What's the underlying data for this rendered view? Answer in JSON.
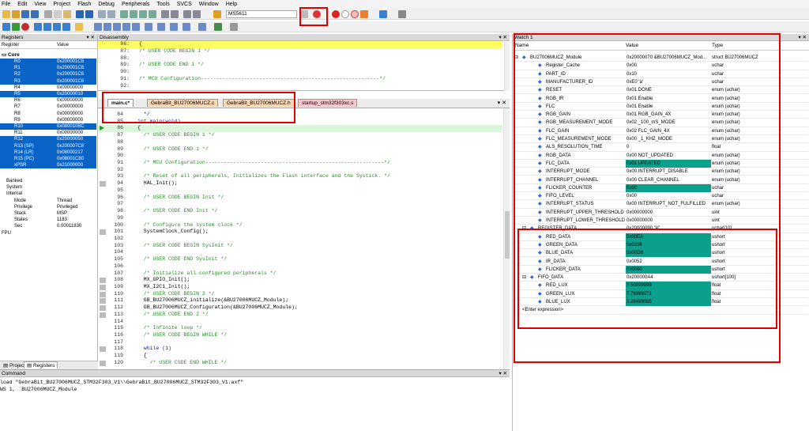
{
  "menu": [
    "File",
    "Edit",
    "View",
    "Project",
    "Flash",
    "Debug",
    "Peripherals",
    "Tools",
    "SVCS",
    "Window",
    "Help"
  ],
  "toolbar": {
    "target": "MS5611"
  },
  "registers": {
    "title": "Registers",
    "col_register": "Register",
    "col_value": "Value",
    "group_core": "Core",
    "rows": [
      {
        "n": "R0",
        "v": "0x200001C8",
        "sel": true
      },
      {
        "n": "R1",
        "v": "0x200001C8",
        "sel": true
      },
      {
        "n": "R2",
        "v": "0x200001C8",
        "sel": true
      },
      {
        "n": "R3",
        "v": "0x200001C8",
        "sel": true
      },
      {
        "n": "R4",
        "v": "0x00000000",
        "sel": false
      },
      {
        "n": "R5",
        "v": "0x20000010",
        "sel": true
      },
      {
        "n": "R6",
        "v": "0x00000000",
        "sel": false
      },
      {
        "n": "R7",
        "v": "0x00000000",
        "sel": false
      },
      {
        "n": "R8",
        "v": "0x00000000",
        "sel": false
      },
      {
        "n": "R9",
        "v": "0x00000000",
        "sel": false
      },
      {
        "n": "R10",
        "v": "0x080010BC",
        "sel": true
      },
      {
        "n": "R11",
        "v": "0x00000000",
        "sel": false
      },
      {
        "n": "R12",
        "v": "0x20000050",
        "sel": true
      },
      {
        "n": "R13 (SP)",
        "v": "0x200007C8",
        "sel": true
      },
      {
        "n": "R14 (LR)",
        "v": "0x08000217",
        "sel": true
      },
      {
        "n": "R15 (PC)",
        "v": "0x08001C80",
        "sel": true
      },
      {
        "n": "xPSR",
        "v": "0x21000000",
        "sel": true
      }
    ],
    "groups": [
      "Banked",
      "System",
      "Internal"
    ],
    "internal": [
      {
        "n": "Mode",
        "v": "Thread"
      },
      {
        "n": "Privilege",
        "v": "Privileged"
      },
      {
        "n": "Stack",
        "v": "MSP"
      },
      {
        "n": "States",
        "v": "1183"
      },
      {
        "n": "Sec",
        "v": "0.00011830"
      }
    ],
    "fpu": "FPU",
    "tab_project": "Project",
    "tab_registers": "Registers"
  },
  "disasm": {
    "title": "Disassembly",
    "lines": [
      {
        "n": "86:",
        "t": "{"
      },
      {
        "n": "87:",
        "t": "/* USER CODE BEGIN 1 */"
      },
      {
        "n": "88:",
        "t": ""
      },
      {
        "n": "89:",
        "t": "/* USER CODE END 1 */"
      },
      {
        "n": "90:",
        "t": ""
      },
      {
        "n": "91:",
        "t": "/* MCU Configuration----------------------------------------------------------*/"
      },
      {
        "n": "92:",
        "t": ""
      }
    ]
  },
  "editor": {
    "tabs": [
      "main.c*",
      "GebraBit_BU27006MUCZ.c",
      "GebraBit_BU27006MUCZ.h",
      "startup_stm32f303xc.s"
    ],
    "lines": [
      {
        "n": "84",
        "t": "  */"
      },
      {
        "n": "85",
        "t": "int main(void)"
      },
      {
        "n": "86",
        "t": "{"
      },
      {
        "n": "87",
        "t": "  /* USER CODE BEGIN 1 */"
      },
      {
        "n": "88",
        "t": ""
      },
      {
        "n": "89",
        "t": "  /* USER CODE END 1 */"
      },
      {
        "n": "90",
        "t": ""
      },
      {
        "n": "91",
        "t": "  /* MCU Configuration----------------------------------------------------------*/"
      },
      {
        "n": "92",
        "t": ""
      },
      {
        "n": "93",
        "t": "  /* Reset of all peripherals, Initializes the Flash interface and the Systick. */"
      },
      {
        "n": "94",
        "t": "  HAL_Init();"
      },
      {
        "n": "95",
        "t": ""
      },
      {
        "n": "96",
        "t": "  /* USER CODE BEGIN Init */"
      },
      {
        "n": "97",
        "t": ""
      },
      {
        "n": "98",
        "t": "  /* USER CODE END Init */"
      },
      {
        "n": "99",
        "t": ""
      },
      {
        "n": "100",
        "t": "  /* Configure the system clock */"
      },
      {
        "n": "101",
        "t": "  SystemClock_Config();"
      },
      {
        "n": "102",
        "t": ""
      },
      {
        "n": "103",
        "t": "  /* USER CODE BEGIN SysInit */"
      },
      {
        "n": "104",
        "t": ""
      },
      {
        "n": "105",
        "t": "  /* USER CODE END SysInit */"
      },
      {
        "n": "106",
        "t": ""
      },
      {
        "n": "107",
        "t": "  /* Initialize all configured peripherals */"
      },
      {
        "n": "108",
        "t": "  MX_GPIO_Init();"
      },
      {
        "n": "109",
        "t": "  MX_I2C1_Init();"
      },
      {
        "n": "110",
        "t": "  /* USER CODE BEGIN 2 */"
      },
      {
        "n": "111",
        "t": "  GB_BU27006MUCZ_initialize(&BU27006MUCZ_Module);"
      },
      {
        "n": "112",
        "t": "  GB_BU27006MUCZ_Configuration(&BU27006MUCZ_Module);"
      },
      {
        "n": "113",
        "t": "  /* USER CODE END 2 */"
      },
      {
        "n": "114",
        "t": ""
      },
      {
        "n": "115",
        "t": "  /* Infinite loop */"
      },
      {
        "n": "116",
        "t": "  /* USER CODE BEGIN WHILE */"
      },
      {
        "n": "117",
        "t": ""
      },
      {
        "n": "118",
        "t": "  while (1)"
      },
      {
        "n": "119",
        "t": "  {"
      },
      {
        "n": "120",
        "t": "    /* USER CODE END WHILE */"
      }
    ]
  },
  "command": {
    "title": "Command",
    "lines": [
      "load \"GebraBit_BU27006MUCZ_STM32F303_V1\\\\GebraBit_BU27006MUCZ_STM32F303_V1.axf\"",
      "WS 1, `BU27006MUCZ_Module"
    ]
  },
  "watch": {
    "title": "Watch 1",
    "col_name": "Name",
    "col_value": "Value",
    "col_type": "Type",
    "rows": [
      {
        "n": "BU27006MUCZ_Module",
        "v": "0x20000070 &BU27006MUCZ_Mod...",
        "t": "struct BU27006MUCZ",
        "lvl": 0,
        "hl": false,
        "exp": true
      },
      {
        "n": "Register_Cache",
        "v": "0x00",
        "t": "uchar",
        "lvl": 1,
        "hl": false
      },
      {
        "n": "PART_ID",
        "v": "0x10",
        "t": "uchar",
        "lvl": 1,
        "hl": false
      },
      {
        "n": "MANUFACTURER_ID",
        "v": "0xE0 'à'",
        "t": "uchar",
        "lvl": 1,
        "hl": false
      },
      {
        "n": "RESET",
        "v": "0x01 DONE",
        "t": "enum (uchar)",
        "lvl": 1,
        "hl": false
      },
      {
        "n": "RGB_IR",
        "v": "0x01 Enable",
        "t": "enum (uchar)",
        "lvl": 1,
        "hl": false
      },
      {
        "n": "FLC",
        "v": "0x01 Enable",
        "t": "enum (uchar)",
        "lvl": 1,
        "hl": false
      },
      {
        "n": "RGB_GAIN",
        "v": "0x01 RGB_GAIN_4X",
        "t": "enum (uchar)",
        "lvl": 1,
        "hl": false
      },
      {
        "n": "RGB_MEASUREMENT_MODE",
        "v": "0x02 _100_mS_MODE",
        "t": "enum (uchar)",
        "lvl": 1,
        "hl": false
      },
      {
        "n": "FLC_GAIN",
        "v": "0x02 FLC_GAIN_4X",
        "t": "enum (uchar)",
        "lvl": 1,
        "hl": false
      },
      {
        "n": "FLC_MEASUREMENT_MODE",
        "v": "0x00 _1_KHZ_MODE",
        "t": "enum (uchar)",
        "lvl": 1,
        "hl": false
      },
      {
        "n": "ALS_RESOLUTION_TIME",
        "v": "0",
        "t": "float",
        "lvl": 1,
        "hl": false
      },
      {
        "n": "RGB_DATA",
        "v": "0x00 NOT_UPDATED",
        "t": "enum (uchar)",
        "lvl": 1,
        "hl": false
      },
      {
        "n": "FLC_DATA",
        "v": "0x01 UPDATED",
        "t": "enum (uchar)",
        "lvl": 1,
        "hl": true
      },
      {
        "n": "INTERRUPT_MODE",
        "v": "0x00 INTERRUPT_DISABLE",
        "t": "enum (uchar)",
        "lvl": 1,
        "hl": false
      },
      {
        "n": "INTERRUPT_CHANNEL",
        "v": "0x00 CLEAR_CHANNEL",
        "t": "enum (uchar)",
        "lvl": 1,
        "hl": false
      },
      {
        "n": "FLICKER_COUNTER",
        "v": "0x00",
        "t": "uchar",
        "lvl": 1,
        "hl": true
      },
      {
        "n": "FIFO_LEVEL",
        "v": "0x00",
        "t": "uchar",
        "lvl": 1,
        "hl": false
      },
      {
        "n": "INTERRUPT_STATUS",
        "v": "0x00 INTERRUPT_NOT_FULFILLED",
        "t": "enum (uchar)",
        "lvl": 1,
        "hl": false
      },
      {
        "n": "INTERRUPT_UPPER_THRESHOLD",
        "v": "0x00000000",
        "t": "uint",
        "lvl": 1,
        "hl": false
      },
      {
        "n": "INTERRUPT_LOWER_THRESHOLD",
        "v": "0x00000000",
        "t": "uint",
        "lvl": 1,
        "hl": false
      },
      {
        "n": "REGISTER_DATA",
        "v": "0x20000090 \"è\"",
        "t": "uchar[10]",
        "lvl": 1,
        "hl": false,
        "exp": true
      },
      {
        "n": "RED_DATA",
        "v": "0x00EA",
        "t": "ushort",
        "lvl": 1,
        "hl": true
      },
      {
        "n": "GREEN_DATA",
        "v": "0x0208",
        "t": "ushort",
        "lvl": 1,
        "hl": true
      },
      {
        "n": "BLUE_DATA",
        "v": "0x00DB",
        "t": "ushort",
        "lvl": 1,
        "hl": true
      },
      {
        "n": "IR_DATA",
        "v": "0x0052",
        "t": "ushort",
        "lvl": 1,
        "hl": false
      },
      {
        "n": "FLICKER_DATA",
        "v": "0x0060",
        "t": "ushort",
        "lvl": 1,
        "hl": true
      },
      {
        "n": "FIFO_DATA",
        "v": "0x200000A4",
        "t": "ushort[100]",
        "lvl": 1,
        "hl": false,
        "exp": true
      },
      {
        "n": "RED_LUX",
        "v": "3.50999999",
        "t": "float",
        "lvl": 1,
        "hl": true
      },
      {
        "n": "GREEN_LUX",
        "v": "7.79999971",
        "t": "float",
        "lvl": 1,
        "hl": true
      },
      {
        "n": "BLUE_LUX",
        "v": "3.28499985",
        "t": "float",
        "lvl": 1,
        "hl": true
      }
    ],
    "enter_expression": "<Enter expression>"
  },
  "colors": {
    "accent": "#0a64c8",
    "highlight": "#0aa08c",
    "annotation": "#e00000"
  }
}
